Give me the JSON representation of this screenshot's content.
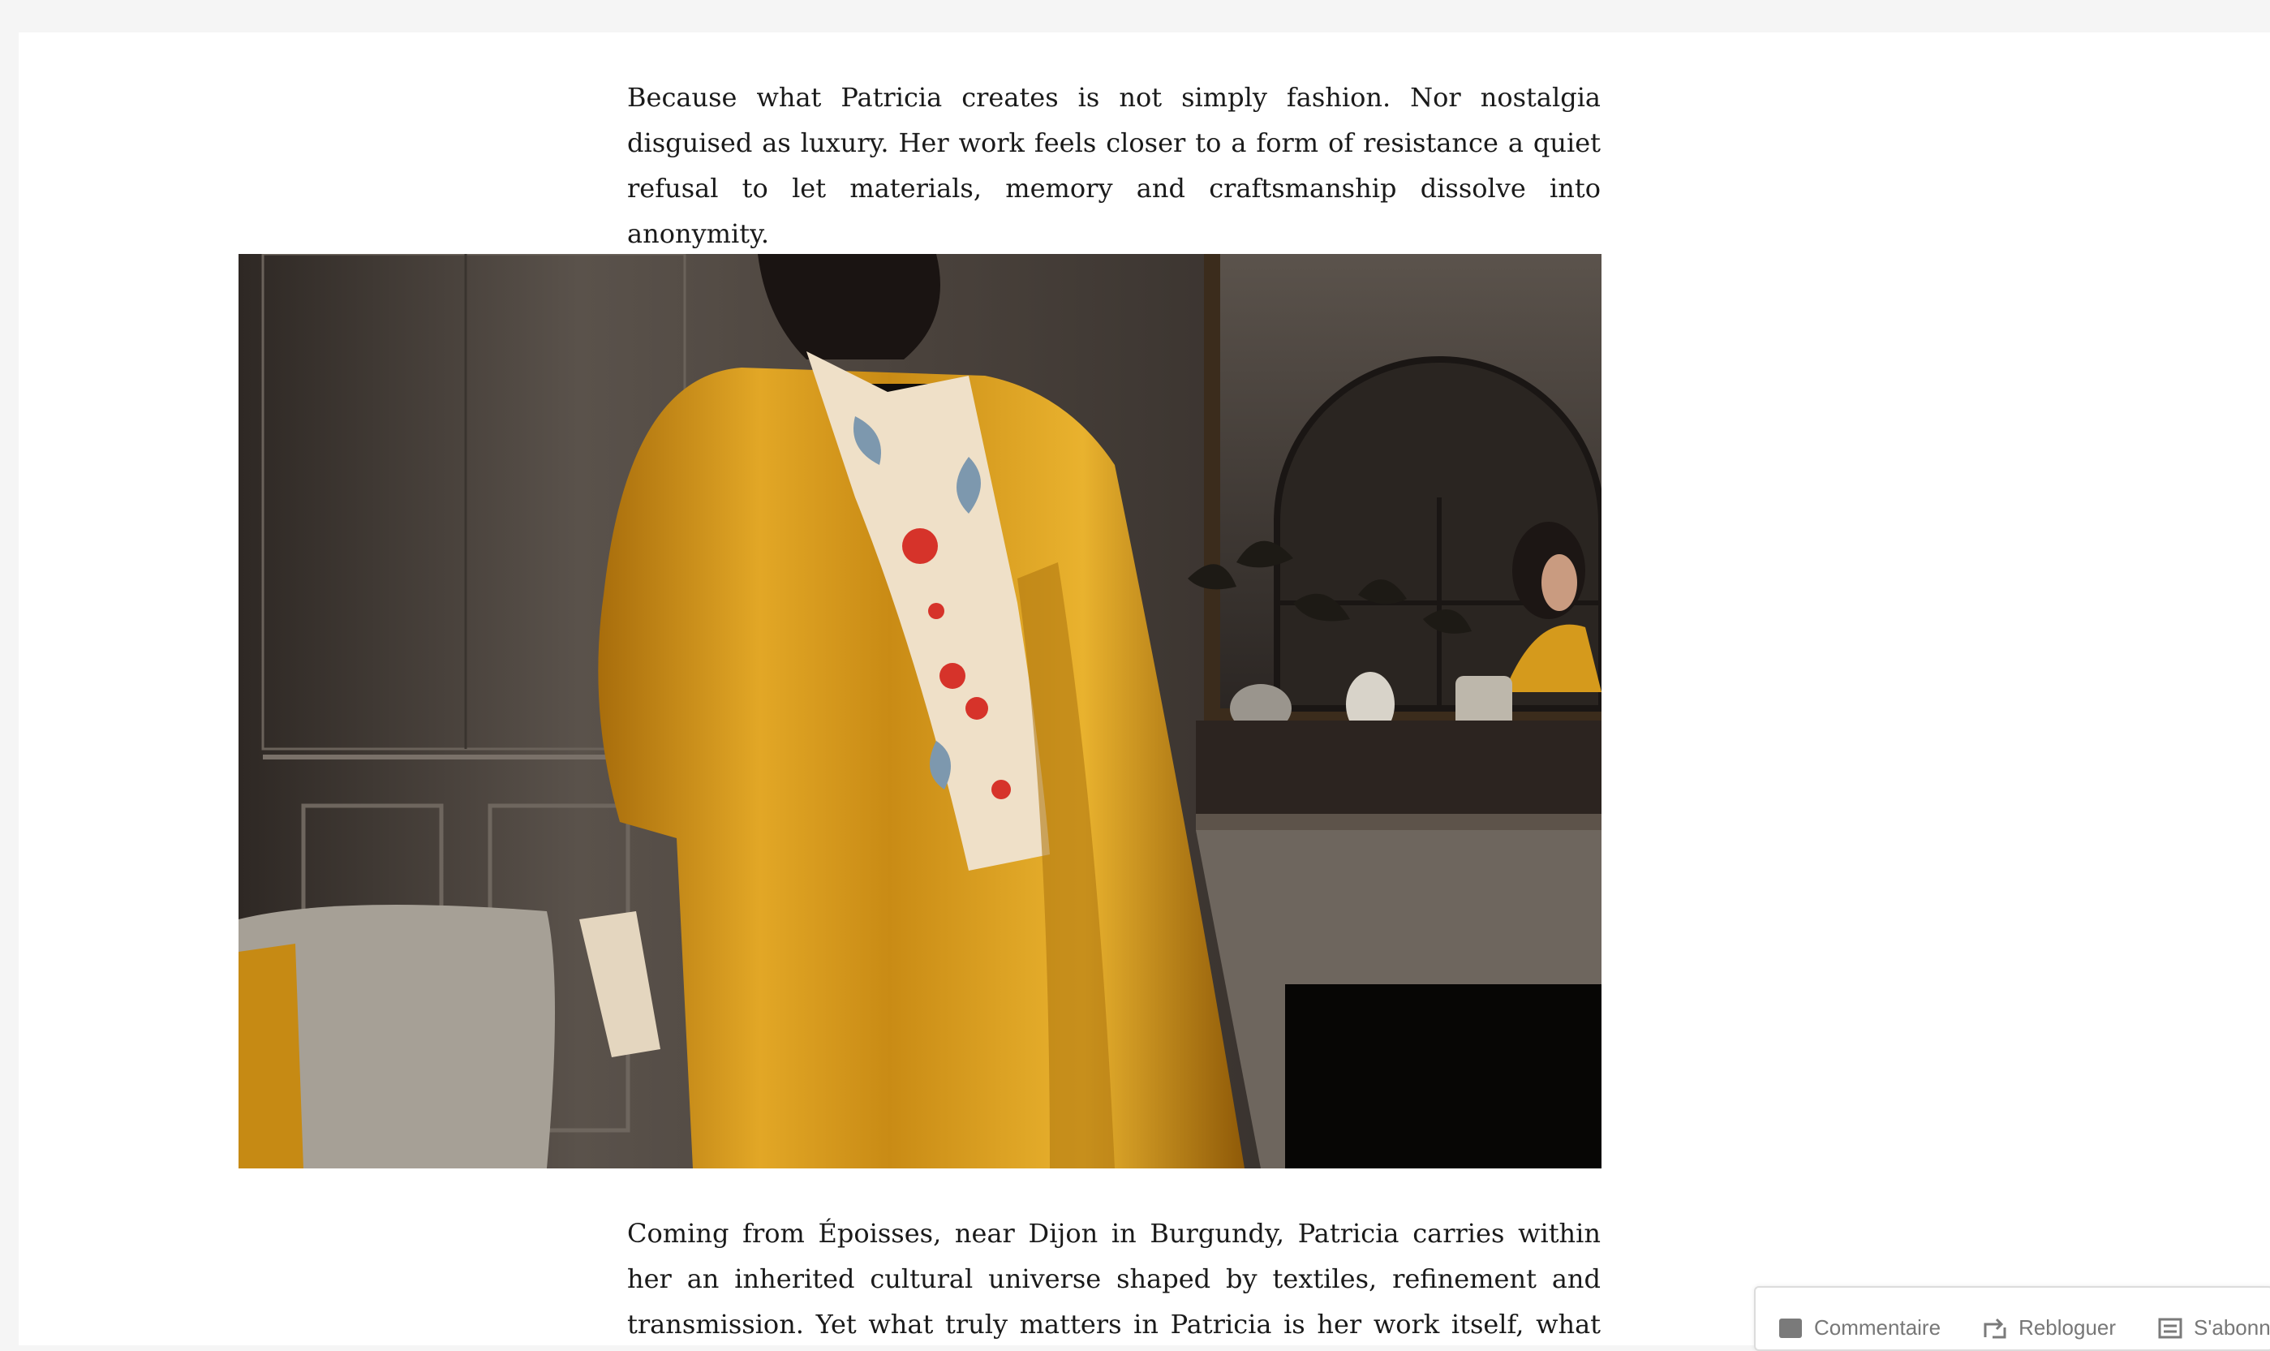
{
  "article": {
    "paragraph_1": "Because what Patricia creates is not simply fashion. Nor nostalgia disguised as luxury. Her work feels closer to a form of resistance a quiet refusal to let materials, memory and craftsmanship dissolve into anonymity.",
    "paragraph_2": "Coming from Époisses, near Dijon in Burgundy, Patricia carries within her an inherited cultural universe shaped by textiles, refinement and transmission. Yet what truly matters in Patricia is her work itself, what she"
  },
  "action_bar": {
    "comment_label": "Commentaire",
    "reblog_label": "Rebloguer",
    "subscribe_label": "S'abonner"
  },
  "icons": [
    "comment-icon",
    "reblog-icon",
    "subscribe-icon"
  ],
  "colors": {
    "page_background": "#ffffff",
    "outer_background": "#f5f5f5",
    "text": "#1a1a1a",
    "coat": "#d59a1c",
    "action_text": "#777777"
  }
}
